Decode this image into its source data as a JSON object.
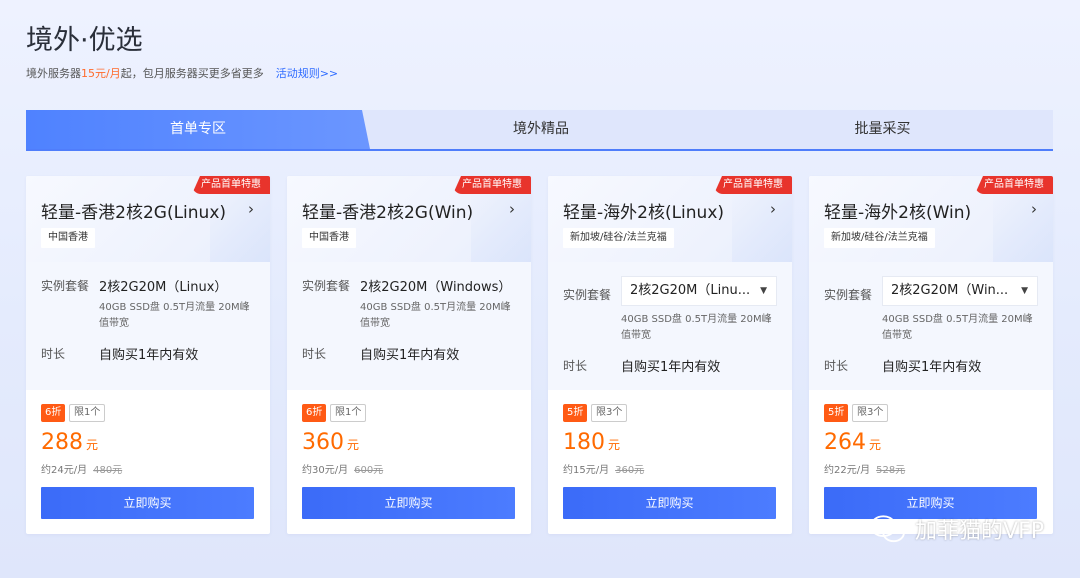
{
  "header": {
    "title": "境外·优选",
    "subtitle_prefix": "境外服务器",
    "subtitle_price": "15元/月",
    "subtitle_suffix": "起，包月服务器买更多省更多",
    "rule_link": "活动规则>>"
  },
  "tabs": [
    {
      "label": "首单专区",
      "active": true
    },
    {
      "label": "境外精品",
      "active": false
    },
    {
      "label": "批量采买",
      "active": false
    }
  ],
  "labels": {
    "package": "实例套餐",
    "duration": "时长",
    "buy": "立即购买"
  },
  "cards": [
    {
      "badge": "产品首单特惠",
      "title": "轻量-香港2核2G(Linux)",
      "region": "中国香港",
      "package": "2核2G20M（Linux）",
      "package_desc": "40GB SSD盘 0.5T月流量 20M峰值带宽",
      "duration": "自购买1年内有效",
      "discount": "6折",
      "limit": "限1个",
      "price": "288",
      "price_unit": "元",
      "monthly": "约24元/月",
      "original": "480元"
    },
    {
      "badge": "产品首单特惠",
      "title": "轻量-香港2核2G(Win)",
      "region": "中国香港",
      "package": "2核2G20M（Windows）",
      "package_desc": "40GB SSD盘 0.5T月流量 20M峰值带宽",
      "duration": "自购买1年内有效",
      "discount": "6折",
      "limit": "限1个",
      "price": "360",
      "price_unit": "元",
      "monthly": "约30元/月",
      "original": "600元"
    },
    {
      "badge": "产品首单特惠",
      "title": "轻量-海外2核(Linux)",
      "region": "新加坡/硅谷/法兰克福",
      "package": "2核2G20M（Linu...",
      "package_desc": "40GB SSD盘 0.5T月流量 20M峰值带宽",
      "duration": "自购买1年内有效",
      "discount": "5折",
      "limit": "限3个",
      "price": "180",
      "price_unit": "元",
      "monthly": "约15元/月",
      "original": "360元"
    },
    {
      "badge": "产品首单特惠",
      "title": "轻量-海外2核(Win)",
      "region": "新加坡/硅谷/法兰克福",
      "package": "2核2G20M（Win...",
      "package_desc": "40GB SSD盘 0.5T月流量 20M峰值带宽",
      "duration": "自购买1年内有效",
      "discount": "5折",
      "limit": "限3个",
      "price": "264",
      "price_unit": "元",
      "monthly": "约22元/月",
      "original": "528元"
    }
  ],
  "watermark": {
    "text": "加菲猫的VFP",
    "icon": "wechat-icon"
  }
}
